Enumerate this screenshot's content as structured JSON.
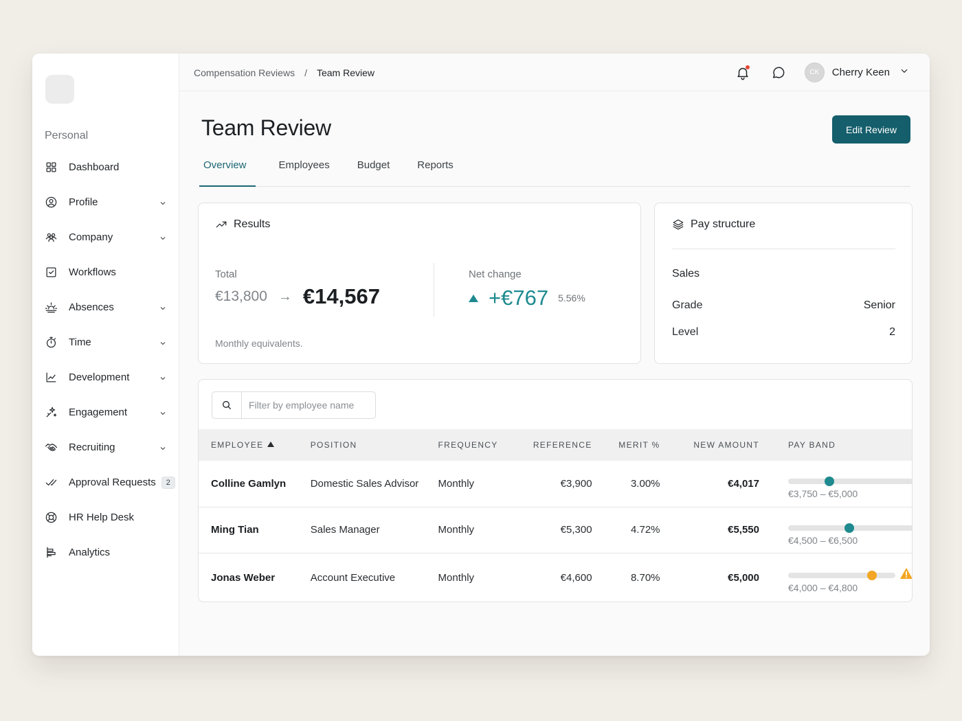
{
  "sidebar": {
    "section": "Personal",
    "items": [
      {
        "label": "Dashboard",
        "icon": "grid-icon",
        "chevron": false
      },
      {
        "label": "Profile",
        "icon": "user-circle-icon",
        "chevron": true
      },
      {
        "label": "Company",
        "icon": "users-icon",
        "chevron": true
      },
      {
        "label": "Workflows",
        "icon": "checkbox-icon",
        "chevron": false
      },
      {
        "label": "Absences",
        "icon": "sunrise-icon",
        "chevron": true
      },
      {
        "label": "Time",
        "icon": "stopwatch-icon",
        "chevron": true
      },
      {
        "label": "Development",
        "icon": "chart-line-icon",
        "chevron": true
      },
      {
        "label": "Engagement",
        "icon": "sparkle-icon",
        "chevron": true
      },
      {
        "label": "Recruiting",
        "icon": "handshake-icon",
        "chevron": true
      },
      {
        "label": "Approval Requests",
        "icon": "check-double-icon",
        "chevron": false,
        "badge": "2"
      },
      {
        "label": "HR Help Desk",
        "icon": "lifebuoy-icon",
        "chevron": false
      },
      {
        "label": "Analytics",
        "icon": "bar-horizontal-icon",
        "chevron": false
      }
    ]
  },
  "topbar": {
    "breadcrumb": [
      "Compensation Reviews",
      "/",
      "Team Review"
    ],
    "user": {
      "initials": "CK",
      "name": "Cherry Keen"
    }
  },
  "page": {
    "title": "Team Review",
    "edit_button": "Edit Review",
    "tabs": [
      "Overview",
      "Employees",
      "Budget",
      "Reports"
    ],
    "active_tab": "Overview"
  },
  "results": {
    "title": "Results",
    "total_label": "Total",
    "old_total": "€13,800",
    "new_total": "€14,567",
    "net_label": "Net change",
    "net_value": "+€767",
    "net_pct": "5.56%",
    "footnote": "Monthly equivalents."
  },
  "pay_structure": {
    "title": "Pay structure",
    "department": "Sales",
    "grade_label": "Grade",
    "grade_value": "Senior",
    "level_label": "Level",
    "level_value": "2"
  },
  "table": {
    "search_placeholder": "Filter by employee name",
    "columns": [
      "EMPLOYEE",
      "POSITION",
      "FREQUENCY",
      "REFERENCE",
      "MERIT %",
      "NEW AMOUNT",
      "PAY BAND"
    ],
    "rows": [
      {
        "employee": "Colline Gamlyn",
        "position": "Domestic Sales Advisor",
        "frequency": "Monthly",
        "reference": "€3,900",
        "merit": "3.00%",
        "new_amount": "€4,017",
        "band_range": "€3,750 – €5,000",
        "band_position": 0.33,
        "band_color": "#1e8a8f",
        "warning": false
      },
      {
        "employee": "Ming Tian",
        "position": "Sales Manager",
        "frequency": "Monthly",
        "reference": "€5,300",
        "merit": "4.72%",
        "new_amount": "€5,550",
        "band_range": "€4,500 – €6,500",
        "band_position": 0.49,
        "band_color": "#1e8a8f",
        "warning": false
      },
      {
        "employee": "Jonas Weber",
        "position": "Account Executive",
        "frequency": "Monthly",
        "reference": "€4,600",
        "merit": "8.70%",
        "new_amount": "€5,000",
        "band_range": "€4,000 – €4,800",
        "band_position": 0.78,
        "band_color": "#f2a623",
        "warning": true
      }
    ]
  },
  "colors": {
    "accent": "#155e6b",
    "positive": "#1e8a8f",
    "warning": "#f2a623",
    "notification": "#e5493a"
  }
}
